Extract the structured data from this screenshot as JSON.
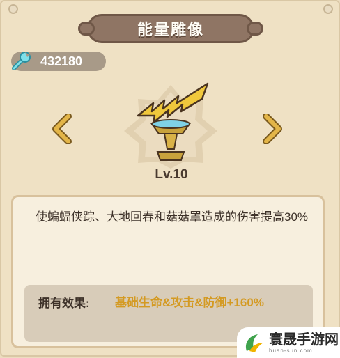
{
  "title": "能量雕像",
  "currency": {
    "icon": "wrench-icon",
    "value": "432180"
  },
  "nav": {
    "prev_icon": "chevron-left-icon",
    "next_icon": "chevron-right-icon"
  },
  "statue": {
    "icon": "lightning-goblet-icon",
    "level": "Lv.10"
  },
  "description": "使蝙蝠侠踪、大地回春和菇菇罩造成的伤害提高30%",
  "effect": {
    "label": "拥有效果:",
    "value": "基础生命&攻击&防御+160%"
  },
  "watermark": {
    "name": "寰晟手游网",
    "url": "huan-sun.com"
  },
  "colors": {
    "banner": "#8f7564",
    "effect_text": "#d49a22",
    "arrow": "#d7a534"
  }
}
